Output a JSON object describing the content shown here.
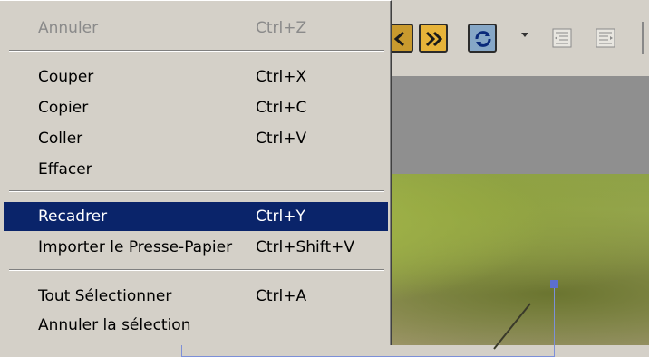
{
  "context_menu": {
    "items": [
      {
        "label": "Annuler",
        "shortcut": "Ctrl+Z",
        "enabled": false
      },
      {
        "label": "Couper",
        "shortcut": "Ctrl+X"
      },
      {
        "label": "Copier",
        "shortcut": "Ctrl+C"
      },
      {
        "label": "Coller",
        "shortcut": "Ctrl+V"
      },
      {
        "label": "Effacer",
        "shortcut": ""
      },
      {
        "label": "Recadrer",
        "shortcut": "Ctrl+Y",
        "highlighted": true
      },
      {
        "label": "Importer le Presse-Papier",
        "shortcut": "Ctrl+Shift+V"
      },
      {
        "label": "Tout Sélectionner",
        "shortcut": "Ctrl+A"
      },
      {
        "label": "Annuler la sélection",
        "shortcut": ""
      }
    ]
  },
  "toolbar": {
    "icons": [
      "previous-icon",
      "next-icon",
      "refresh-icon",
      "dropdown-arrow-icon",
      "indent-left-icon",
      "indent-right-icon"
    ]
  },
  "colors": {
    "menu_bg": "#d4d0c8",
    "highlight_bg": "#0a246a",
    "highlight_text": "#ffffff",
    "disabled_text": "#8a8a8a",
    "selection_border": "#7c8fd8"
  }
}
